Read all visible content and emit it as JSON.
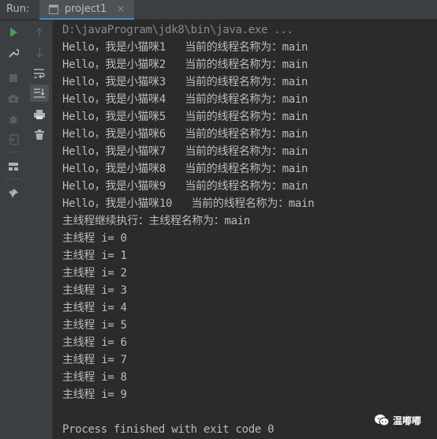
{
  "header": {
    "run_label": "Run:",
    "tab_title": "project1",
    "tab_close": "×"
  },
  "toolbar": {
    "left": [
      "run-icon",
      "wrench-icon",
      "stop-icon",
      "camera-icon",
      "debug-bug-icon",
      "exit-icon",
      "layout-icon",
      "pin-icon"
    ],
    "right": [
      "up-arrow-icon",
      "down-arrow-icon",
      "soft-wrap-icon",
      "scroll-to-end-icon",
      "print-icon",
      "trash-icon"
    ]
  },
  "console": {
    "lines": [
      "D:\\javaProgram\\jdk8\\bin\\java.exe ...",
      "Hello，我是小猫咪1   当前的线程名称为：main",
      "Hello，我是小猫咪2   当前的线程名称为：main",
      "Hello，我是小猫咪3   当前的线程名称为：main",
      "Hello，我是小猫咪4   当前的线程名称为：main",
      "Hello，我是小猫咪5   当前的线程名称为：main",
      "Hello，我是小猫咪6   当前的线程名称为：main",
      "Hello，我是小猫咪7   当前的线程名称为：main",
      "Hello，我是小猫咪8   当前的线程名称为：main",
      "Hello，我是小猫咪9   当前的线程名称为：main",
      "Hello，我是小猫咪10   当前的线程名称为：main",
      "主线程继续执行：主线程名称为：main",
      "主线程 i= 0",
      "主线程 i= 1",
      "主线程 i= 2",
      "主线程 i= 3",
      "主线程 i= 4",
      "主线程 i= 5",
      "主线程 i= 6",
      "主线程 i= 7",
      "主线程 i= 8",
      "主线程 i= 9",
      "",
      "Process finished with exit code 0"
    ]
  },
  "watermark": {
    "text": "温嘟嘟"
  },
  "colors": {
    "console_bg": "#2b2b2b",
    "panel_bg": "#3c3f41",
    "text": "#bbbbbb",
    "run_green": "#499c54",
    "accent": "#4a88c7"
  }
}
